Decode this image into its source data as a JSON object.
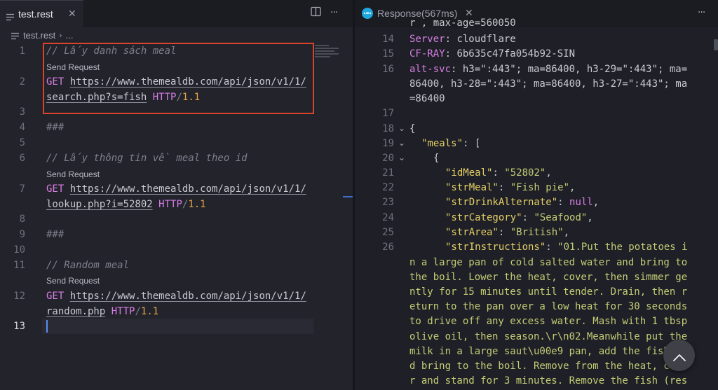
{
  "left_tab": {
    "label": "test.rest",
    "close": "✕"
  },
  "left_toolbar": {
    "split": "▥",
    "more": "···"
  },
  "breadcrumb": {
    "file": "test.rest",
    "rest": "..."
  },
  "editor": {
    "lines": {
      "l1": "1",
      "l2": "2",
      "l3": "3",
      "l4": "4",
      "l5": "5",
      "l6": "6",
      "l7": "7",
      "l8": "8",
      "l9": "9",
      "l10": "10",
      "l11": "11",
      "l12": "12",
      "l13": "13"
    },
    "send_request": "Send Request",
    "method": "GET",
    "http": "HTTP",
    "slash": "/",
    "version": "1.1",
    "separator": "###",
    "req1": {
      "comment": "// Lấy danh sách meal",
      "url_a": "https://www.themealdb.com/api/json/v1/1/",
      "url_b": "search.php?s=fish"
    },
    "req2": {
      "comment": "// Lấy thông tin về meal theo id",
      "url_a": "https://www.themealdb.com/api/json/v1/1/",
      "url_b": "lookup.php?i=52802"
    },
    "req3": {
      "comment": "// Random meal",
      "url_a": "https://www.themealdb.com/api/json/v1/1/",
      "url_b": "random.php"
    }
  },
  "right_tab": {
    "label": "Response(567ms)",
    "close": "✕",
    "more": "···"
  },
  "response": {
    "partial_top": "r , max-age=560050",
    "nums": {
      "n14": "14",
      "n15": "15",
      "n16": "16",
      "n17": "17",
      "n18": "18",
      "n19": "19",
      "n20": "20",
      "n21": "21",
      "n22": "22",
      "n23": "23",
      "n24": "24",
      "n25": "25",
      "n26": "26"
    },
    "server_key": "Server",
    "server_val": "cloudflare",
    "cfray_key": "CF-RAY",
    "cfray_val": "6b635c47fa054b92-SIN",
    "altsvc_key": "alt-svc",
    "altsvc_1": "h3=\":443\"; ma=86400, h3-29=\":443\"; ma=",
    "altsvc_2": "86400, h3-28=\":443\"; ma=86400, h3-27=\":443\"; ma",
    "altsvc_3": "=86400",
    "brace": "{",
    "meals_key": "\"meals\"",
    "meals_tail": ": [",
    "obj_open": "{",
    "k_id": "\"idMeal\"",
    "v_id": "\"52802\"",
    "k_meal": "\"strMeal\"",
    "v_meal": "\"Fish pie\"",
    "k_drink": "\"strDrinkAlternate\"",
    "v_drink": "null",
    "k_cat": "\"strCategory\"",
    "v_cat": "\"Seafood\"",
    "k_area": "\"strArea\"",
    "v_area": "\"British\"",
    "k_instr": "\"strInstructions\"",
    "instr_1": "\"01.Put the potatoes i",
    "instr_2": "n a large pan of cold salted water and bring to",
    "instr_3": "the boil. Lower the heat, cover, then simmer ge",
    "instr_4": "ntly for 15 minutes until tender. Drain, then r",
    "instr_5": "eturn to the pan over a low heat for 30 seconds",
    "instr_6": "to drive off any excess water. Mash with 1 tbsp",
    "instr_7": "olive oil, then season.\\r\\n02.Meanwhile put the",
    "instr_8": "milk in a large saut\\u00e9 pan, add the fish an",
    "instr_9": "d bring to the boil. Remove from the heat, cove",
    "instr_10": "r and stand for 3 minutes. Remove the fish (res"
  },
  "scroll_top": {
    "icon": "chevron-up"
  },
  "colors": {
    "highlight": "#d9442c",
    "keyword": "#d77ee4",
    "version": "#e9a24a",
    "json_key": "#e3cf67",
    "json_string": "#c4cc75"
  }
}
